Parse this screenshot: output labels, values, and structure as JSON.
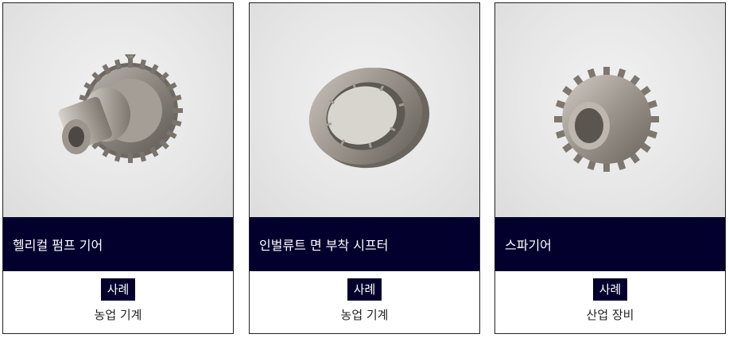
{
  "products": [
    {
      "title": "헬리컬 펌프 기어",
      "badge": "사례",
      "industry": "농업 기계",
      "image": "helical-gear-image"
    },
    {
      "title": "인벌류트 면 부착 시프터",
      "badge": "사례",
      "industry": "농업 기계",
      "image": "shifter-ring-image"
    },
    {
      "title": "스파기어",
      "badge": "사례",
      "industry": "산업 장비",
      "image": "spur-gear-image"
    }
  ],
  "colors": {
    "band": "#04002d",
    "badge": "#04002d",
    "border": "#222222"
  }
}
